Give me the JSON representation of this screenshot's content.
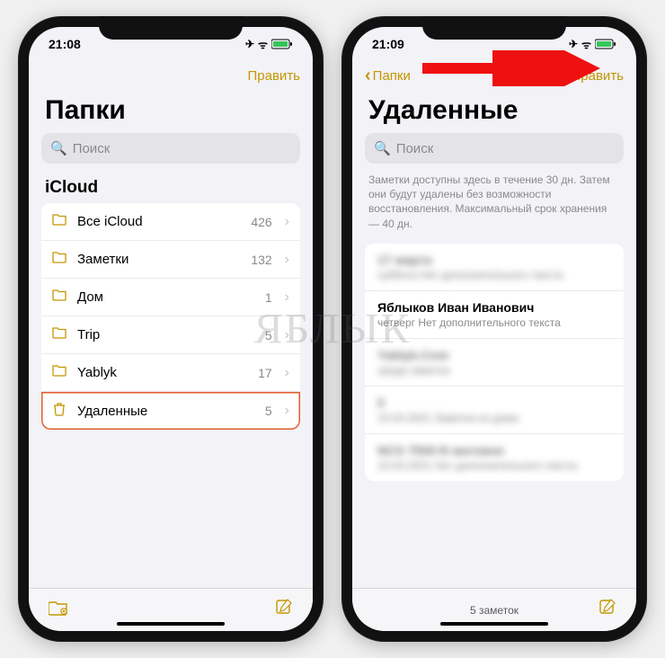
{
  "watermark": "ЯБЛЫК",
  "left": {
    "time": "21:08",
    "edit": "Править",
    "title": "Папки",
    "search_placeholder": "Поиск",
    "section": "iCloud",
    "folders": [
      {
        "icon": "folder",
        "name": "Все iCloud",
        "count": "426"
      },
      {
        "icon": "folder",
        "name": "Заметки",
        "count": "132"
      },
      {
        "icon": "folder",
        "name": "Дом",
        "count": "1"
      },
      {
        "icon": "folder",
        "name": "Trip",
        "count": "5"
      },
      {
        "icon": "folder",
        "name": "Yablyk",
        "count": "17"
      },
      {
        "icon": "trash",
        "name": "Удаленные",
        "count": "5",
        "highlight": true
      }
    ]
  },
  "right": {
    "time": "21:09",
    "back": "Папки",
    "edit": "Править",
    "title": "Удаленные",
    "search_placeholder": "Поиск",
    "info": "Заметки доступны здесь в течение 30 дн. Затем они будут удалены без возможности восстановления. Максимальный срок хранения — 40 дн.",
    "notes": [
      {
        "title": "17 марта",
        "subtitle": "суббота  Нет дополнительного текста",
        "blur": true
      },
      {
        "title": "Яблыков Иван Иванович",
        "subtitle": "четверг  Нет дополнительного текста",
        "blur": false
      },
      {
        "title": "Yablyk.Com",
        "subtitle": "среда  заметка",
        "blur": true
      },
      {
        "title": "0",
        "subtitle": "10.03.2021  Заметка из дома",
        "blur": true
      },
      {
        "title": "NCS 7500-N матовое",
        "subtitle": "10.03.2021  Нет дополнительного текста",
        "blur": true
      }
    ],
    "footer_count": "5 заметок"
  },
  "status_icons": {
    "airplane": "✈︎",
    "wifi": "ᯤ",
    "battery": "▮▮"
  },
  "icons": {
    "search": "🔍",
    "chevron": "›",
    "back_chevron": "‹",
    "new_folder": "🗂",
    "compose": "✎",
    "folder": "📁",
    "trash": "🗑"
  }
}
